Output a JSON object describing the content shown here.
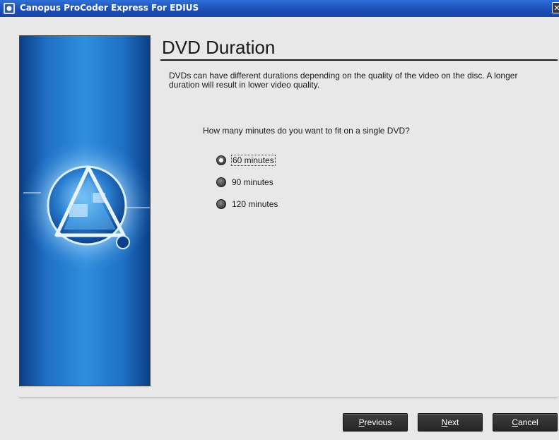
{
  "window": {
    "title": "Canopus ProCoder Express For EDIUS",
    "close_glyph": "✕"
  },
  "page": {
    "title": "DVD Duration",
    "description": "DVDs can have different durations depending on the quality of the video on the disc. A longer duration will result in lower video quality.",
    "question": "How many minutes do you want to fit on a single DVD?"
  },
  "options": [
    {
      "label": "60 minutes",
      "checked": true
    },
    {
      "label": "90 minutes",
      "checked": false
    },
    {
      "label": "120 minutes",
      "checked": false
    }
  ],
  "buttons": {
    "previous_key": "P",
    "previous_rest": "revious",
    "next_key": "N",
    "next_rest": "ext",
    "cancel_key": "C",
    "cancel_rest": "ancel"
  },
  "icons": {
    "app": "canopus-app-icon",
    "close": "close-icon",
    "artwork": "canopus-sphere-artwork"
  },
  "colors": {
    "titlebar": "#1c4fb8",
    "panel_blue": "#2f8ede",
    "button": "#2e2e2e"
  }
}
